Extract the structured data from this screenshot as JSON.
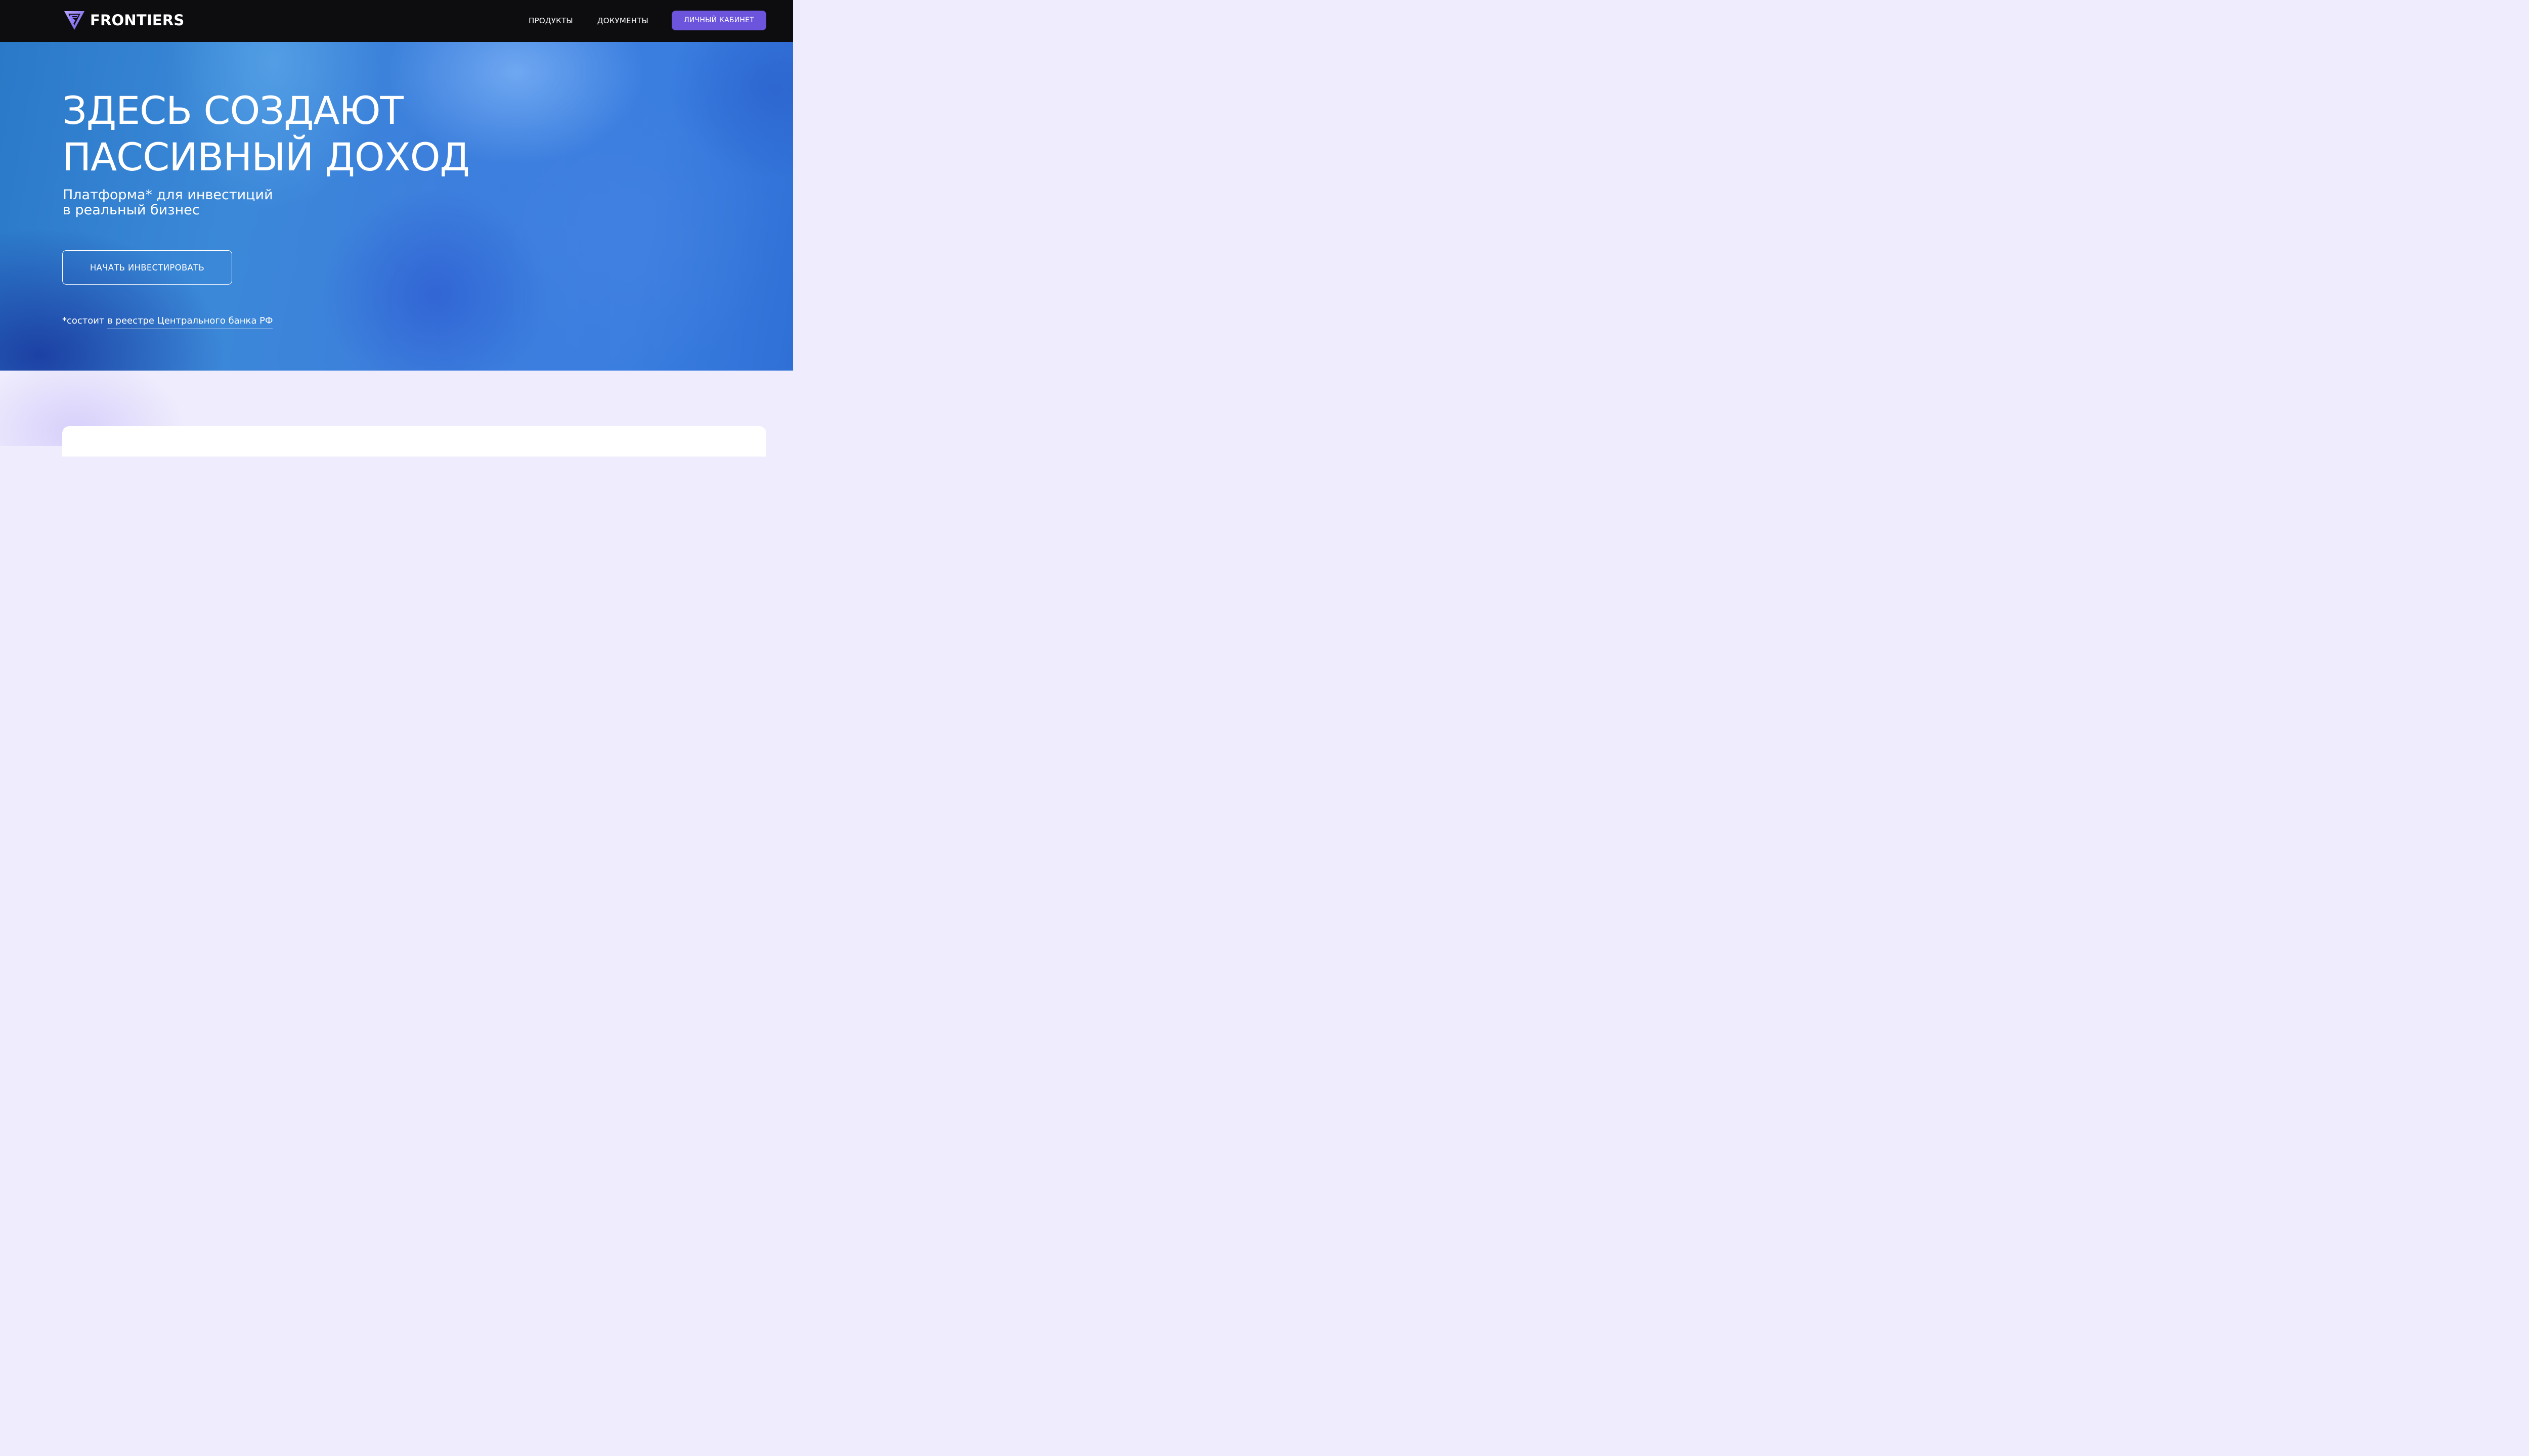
{
  "header": {
    "logo_text": "FRONTIERS",
    "logo_icon": "frontiers-logo-mark",
    "nav": [
      {
        "label": "ПРОДУКТЫ"
      },
      {
        "label": "ДОКУМЕНТЫ"
      }
    ],
    "cabinet_label": "ЛИЧНЫЙ КАБИНЕТ"
  },
  "hero": {
    "title_lines": [
      "ЗДЕСЬ СОЗДАЮТ",
      "ПАССИВНЫЙ ДОХОД"
    ],
    "subtitle_lines": [
      "Платформа* для инвестиций",
      "в реальный бизнес"
    ],
    "cta_label": "НАЧАТЬ ИНВЕСТИРОВАТЬ",
    "footnote_prefix": "*состоит ",
    "footnote_link": "в реестре Центрального банка РФ"
  },
  "colors": {
    "topbar_bg": "#0d0d10",
    "accent": "#6c55dc",
    "hero_blue": "#3b80dc",
    "lower_bg": "#efedfd",
    "card_bg": "#ffffff"
  }
}
